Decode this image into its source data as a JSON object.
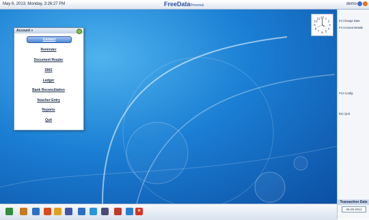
{
  "topbar": {
    "datetime": "May  6, 2013, Monday, 3:26:27 PM",
    "brand": "FreeData",
    "brand_sub": "Personal",
    "user": "demo"
  },
  "menu": {
    "title": "Account »",
    "items": [
      {
        "label": "Contact",
        "active": true
      },
      {
        "label": "Reminder"
      },
      {
        "label": "Document Reader"
      },
      {
        "label": "DMS"
      },
      {
        "label": "Ledger"
      },
      {
        "label": "Bank Reconciliation"
      },
      {
        "label": "Voucher Entry"
      },
      {
        "label": "Reports"
      },
      {
        "label": "Quit"
      }
    ]
  },
  "right_panel": {
    "shortcuts": [
      "F2 Change Date",
      "F3 Account Details",
      "F12 Config",
      "Esc Quit"
    ],
    "transaction_title": "Transaction Date",
    "transaction_date": "06-05-2013"
  },
  "clock": {
    "numerals": [
      "12",
      "1",
      "2",
      "3",
      "4",
      "5",
      "6",
      "7",
      "8",
      "9",
      "10",
      "11"
    ]
  },
  "taskbar": {
    "icons": [
      "hand-icon",
      "printer-icon",
      "network-icon",
      "gift-icon",
      "folder-icon",
      "book-icon",
      "window-icon",
      "monitor-icon",
      "building-icon",
      "calendar-icon",
      "globe-icon",
      "close-icon"
    ],
    "colors": [
      "#2f8f3a",
      "#c77a1c",
      "#2a6fc4",
      "#d94b1f",
      "#e0a21a",
      "#3f56a8",
      "#2a6fc4",
      "#2596d9",
      "#4a4a7a",
      "#c0392b",
      "#2a7fd4",
      "#d93020"
    ]
  }
}
